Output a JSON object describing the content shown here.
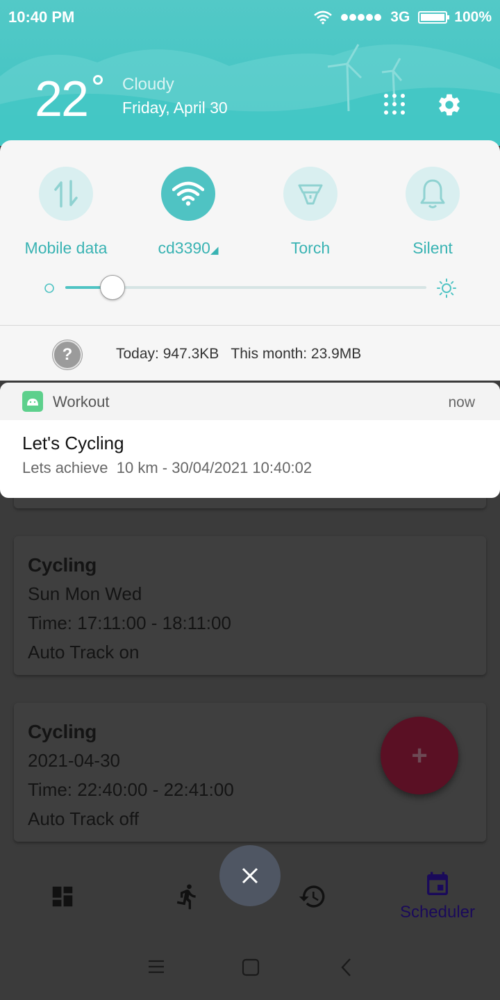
{
  "status_bar": {
    "time": "10:40 PM",
    "network": "3G",
    "battery": "100%"
  },
  "weather": {
    "temperature": "22",
    "condition": "Cloudy",
    "date": "Friday, April 30"
  },
  "quick_settings": {
    "tiles": [
      {
        "label": "Mobile data",
        "icon": "mobile-data-icon",
        "active": false
      },
      {
        "label": "cd3390",
        "icon": "wifi-icon",
        "active": true
      },
      {
        "label": "Torch",
        "icon": "torch-icon",
        "active": false
      },
      {
        "label": "Silent",
        "icon": "bell-icon",
        "active": false
      }
    ],
    "brightness_level": 0.13,
    "data_usage": {
      "help": "?",
      "text": "Today: 947.3KB   This month: 23.9MB"
    }
  },
  "notification": {
    "app_name": "Workout",
    "time": "now",
    "title": "Let's Cycling",
    "body": "Lets achieve  10 km - 30/04/2021 10:40:02"
  },
  "background_app": {
    "cards": [
      {
        "title": "Cycling",
        "line1": "Sun Mon Wed",
        "line2": "Time: 17:11:00 - 18:11:00",
        "line3": "Auto Track on"
      },
      {
        "title": "Cycling",
        "line1": "2021-04-30",
        "line2": "Time: 22:40:00 - 22:41:00",
        "line3": "Auto Track off"
      }
    ],
    "fab_label": "+",
    "nav": {
      "items": [
        {
          "icon": "dashboard-icon",
          "label": ""
        },
        {
          "icon": "run-icon",
          "label": ""
        },
        {
          "icon": "history-icon",
          "label": ""
        },
        {
          "icon": "calendar-icon",
          "label": "Scheduler"
        }
      ]
    }
  },
  "colors": {
    "accent": "#4fc3c3",
    "header": "#3ec3c2",
    "fab": "#5a1024",
    "nav_active": "#1a0a5a"
  }
}
